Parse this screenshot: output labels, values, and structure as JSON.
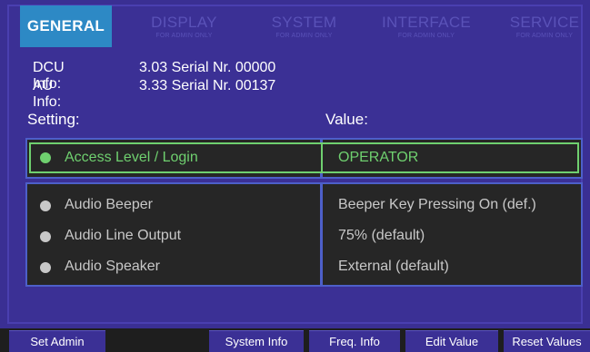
{
  "tabs": [
    {
      "title": "GENERAL",
      "sub": ""
    },
    {
      "title": "DISPLAY",
      "sub": "FOR ADMIN ONLY"
    },
    {
      "title": "SYSTEM",
      "sub": "FOR ADMIN ONLY"
    },
    {
      "title": "INTERFACE",
      "sub": "FOR ADMIN ONLY"
    },
    {
      "title": "SERVICE",
      "sub": "FOR ADMIN ONLY"
    }
  ],
  "info": {
    "dcu_label": "DCU Info:",
    "dcu_value": "3.03 Serial Nr. 00000",
    "au_label": "AU Info:",
    "au_value": "3.33 Serial Nr. 00137"
  },
  "headers": {
    "setting": "Setting:",
    "value": "Value:"
  },
  "selected": {
    "setting": "Access Level / Login",
    "value": "OPERATOR"
  },
  "rows": [
    {
      "setting": "Audio Beeper",
      "value": "Beeper Key Pressing On (def.)"
    },
    {
      "setting": "Audio Line Output",
      "value": "75% (default)"
    },
    {
      "setting": "Audio Speaker",
      "value": "External (default)"
    }
  ],
  "buttons": {
    "set_admin": "Set Admin",
    "system_info": "System Info",
    "freq_info": "Freq. Info",
    "edit_value": "Edit Value",
    "reset_values": "Reset Values"
  },
  "colors": {
    "active_tab": "#2d89c5",
    "selected": "#6fd06f",
    "inactive_text": "#c8c8c8",
    "background": "#3a2f93"
  }
}
